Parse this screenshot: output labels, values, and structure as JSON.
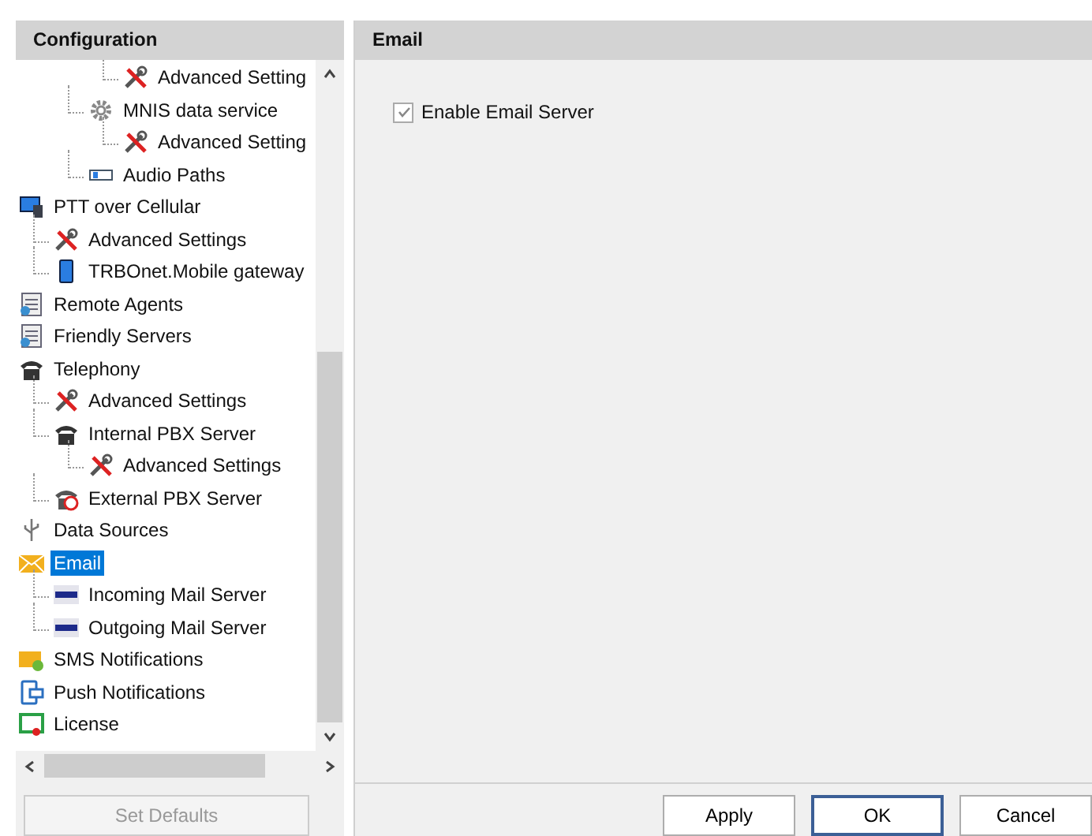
{
  "left_panel": {
    "title": "Configuration",
    "tree": {
      "continued_level3": [
        {
          "label": "Advanced Setting",
          "kind": "wrench",
          "selected": false
        }
      ],
      "continued_level2": [
        {
          "label": "MNIS data service",
          "kind": "gear",
          "selected": false,
          "children": [
            {
              "label": "Advanced Setting",
              "kind": "wrench",
              "selected": false
            }
          ]
        },
        {
          "label": "Audio Paths",
          "kind": "audio",
          "selected": false
        }
      ],
      "items": [
        {
          "label": "PTT over Cellular",
          "kind": "monitor",
          "selected": false,
          "children": [
            {
              "label": "Advanced Settings",
              "kind": "wrench",
              "selected": false
            },
            {
              "label": "TRBOnet.Mobile gateway",
              "kind": "phone",
              "selected": false
            }
          ]
        },
        {
          "label": "Remote Agents",
          "kind": "server",
          "selected": false
        },
        {
          "label": "Friendly Servers",
          "kind": "server",
          "selected": false
        },
        {
          "label": "Telephony",
          "kind": "telephone",
          "selected": false,
          "children": [
            {
              "label": "Advanced Settings",
              "kind": "wrench",
              "selected": false
            },
            {
              "label": "Internal PBX Server",
              "kind": "telephone",
              "selected": false,
              "children": [
                {
                  "label": "Advanced Settings",
                  "kind": "wrench",
                  "selected": false
                }
              ]
            },
            {
              "label": "External PBX Server",
              "kind": "pbx",
              "selected": false
            }
          ]
        },
        {
          "label": "Data Sources",
          "kind": "usb",
          "selected": false
        },
        {
          "label": "Email",
          "kind": "envelope",
          "selected": true,
          "children": [
            {
              "label": "Incoming Mail Server",
              "kind": "pop3",
              "selected": false
            },
            {
              "label": "Outgoing Mail Server",
              "kind": "smtp",
              "selected": false
            }
          ]
        },
        {
          "label": "SMS Notifications",
          "kind": "sms",
          "selected": false
        },
        {
          "label": "Push Notifications",
          "kind": "push",
          "selected": false
        },
        {
          "label": "License",
          "kind": "license",
          "selected": false
        }
      ]
    },
    "set_defaults_button": {
      "label": "Set Defaults",
      "disabled": true
    }
  },
  "right_panel": {
    "title": "Email",
    "enable_email_server": {
      "label": "Enable Email Server",
      "checked": true
    },
    "buttons": [
      {
        "label": "Apply",
        "default": false
      },
      {
        "label": "OK",
        "default": true
      },
      {
        "label": "Cancel",
        "default": false
      }
    ]
  }
}
